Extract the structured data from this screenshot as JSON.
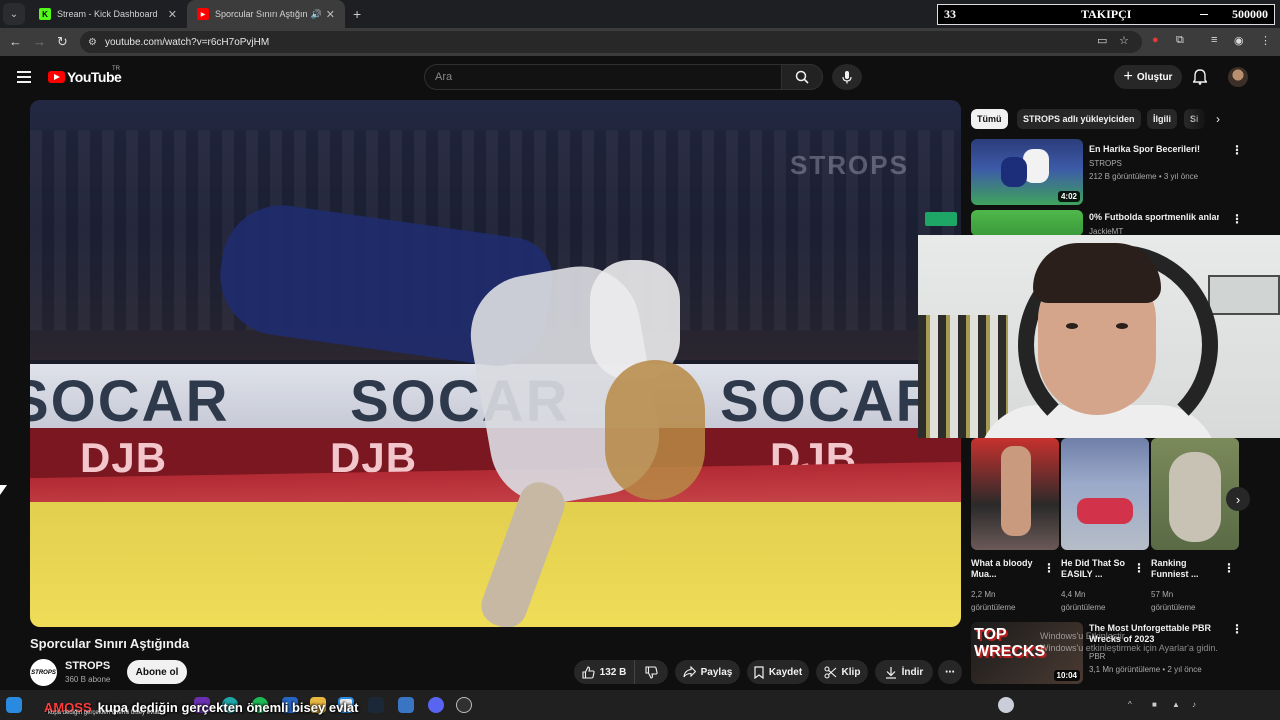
{
  "browser": {
    "tabs": [
      {
        "label": "Stream - Kick Dashboard",
        "favicon": "K",
        "color": "#53fc18"
      },
      {
        "label": "Sporcular Sınırı Aştığında -",
        "favicon": "▶",
        "color": "#ff0000"
      }
    ],
    "url": "youtube.com/watch?v=r6cH7oPvjHM"
  },
  "follower_goal": {
    "count": "33",
    "label": "TAKIPÇI",
    "goal": "500000"
  },
  "youtube": {
    "logo_text": "YouTube",
    "region": "TR",
    "search_placeholder": "Ara",
    "create_label": "Oluştur"
  },
  "video": {
    "title": "Sporcular Sınırı Aştığında",
    "channel": "STROPS",
    "channel_avatar_text": "STROPS",
    "subscribers": "360 B abone",
    "subscribe_label": "Abone ol",
    "likes": "132 B",
    "share_label": "Paylaş",
    "save_label": "Kaydet",
    "clip_label": "Klip",
    "download_label": "İndir",
    "banner_brand": "SOCAR",
    "banner_sponsor": "DJB",
    "watermark": "STROPS"
  },
  "sidebar": {
    "chips": [
      "Tümü",
      "STROPS adlı yükleyiciden",
      "İlgili",
      "Si"
    ],
    "recommendations": [
      {
        "title": "En Harika Spor Becerileri!",
        "channel": "STROPS",
        "meta": "212 B görüntüleme • 3 yıl önce",
        "duration": "4:02"
      },
      {
        "title": "0% Futbolda sportmenlik anları",
        "channel": "JackieMT"
      }
    ],
    "shorts": [
      {
        "title": "What a bloody Mua...",
        "views": "2,2 Mn",
        "views_label": "görüntüleme"
      },
      {
        "title": "He Did That So EASILY ...",
        "views": "4,4 Mn",
        "views_label": "görüntüleme"
      },
      {
        "title": "Ranking Funniest ...",
        "views": "57 Mn",
        "views_label": "görüntüleme"
      }
    ],
    "bottom_rec": {
      "title": "The Most Unforgettable PBR Wrecks of 2023",
      "channel": "PBR",
      "meta": "3,1 Mn görüntüleme • 2 yıl önce",
      "duration": "10:04",
      "thumb_text": "TOP WRECKS"
    }
  },
  "overlay": {
    "windows_line1": "Windows'u Etkinleştir",
    "windows_line2": "Windows'u etkinleştirmek için Ayarlar'a gidin."
  },
  "chat": {
    "user": "AMOSS",
    "message": "kupa dediğin gerçekten önemli bisey evlat",
    "small_echo": "kupa dediğin gerçekten önemli bisey evlat"
  }
}
